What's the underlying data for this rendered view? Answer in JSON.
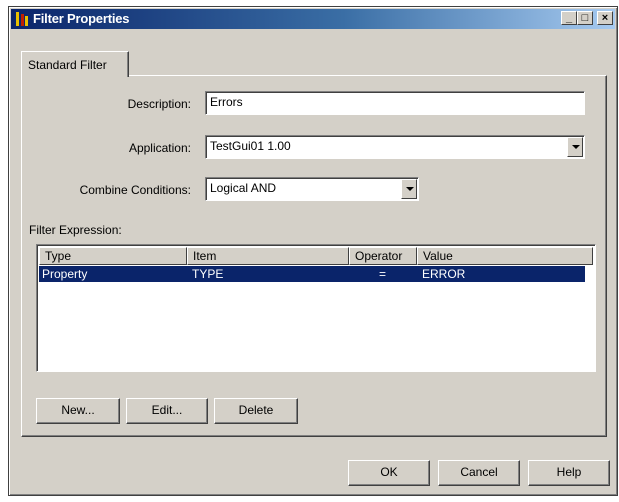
{
  "window": {
    "title": "Filter Properties"
  },
  "tab": {
    "label": "Standard Filter"
  },
  "form": {
    "description_label": "Description:",
    "description_value": "Errors",
    "application_label": "Application:",
    "application_value": "TestGui01 1.00",
    "combine_label": "Combine Conditions:",
    "combine_value": "Logical AND",
    "expression_label": "Filter Expression:"
  },
  "table": {
    "columns": [
      "Type",
      "Item",
      "Operator",
      "Value"
    ],
    "rows": [
      {
        "type": "Property",
        "item": "TYPE",
        "operator": "=",
        "value": "ERROR"
      }
    ]
  },
  "expr_buttons": {
    "new": "New...",
    "edit": "Edit...",
    "delete": "Delete"
  },
  "dialog_buttons": {
    "ok": "OK",
    "cancel": "Cancel",
    "help": "Help"
  },
  "colors": {
    "title_bar": "#0a246a",
    "selection": "#0a246a",
    "face": "#d4d0c8"
  }
}
